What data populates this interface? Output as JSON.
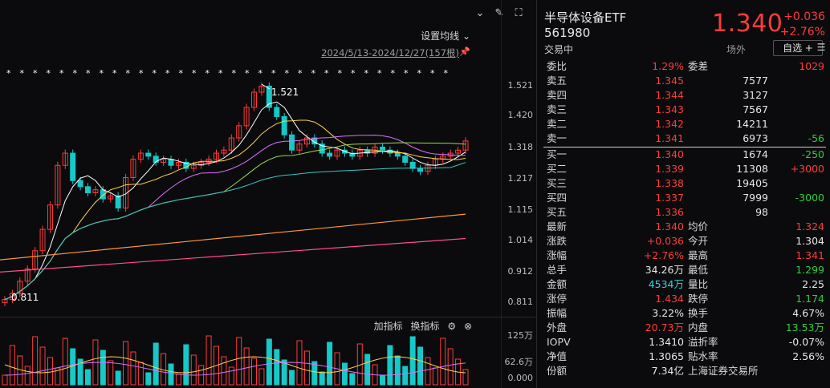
{
  "chart": {
    "ma_settings": "设置均线",
    "range": "2024/5/13-2024/12/27(157根)",
    "price_ticks": [
      "1.521",
      "1.420",
      "1.318",
      "1.217",
      "1.115",
      "1.014",
      "0.912",
      "0.811"
    ],
    "max_label": "1.521",
    "min_label": "0.811",
    "volume_tools": {
      "add": "加指标",
      "swap": "换指标"
    },
    "volume_ticks": [
      "125万",
      "62.6万",
      "0.000"
    ],
    "colors": {
      "up": "#ff3b3b",
      "down": "#16c8c8",
      "ma5": "#ffffff",
      "ma10": "#ffd24a",
      "ma20": "#e070ff",
      "ma30": "#9bd94a",
      "ma60": "#38c6c0",
      "ma120": "#ff9a30",
      "ma250": "#ff4d88"
    }
  },
  "chart_data": {
    "type": "candlestick",
    "ylim": [
      0.811,
      1.521
    ],
    "ohlc_close_approx": [
      0.82,
      0.84,
      0.88,
      0.92,
      0.98,
      1.05,
      1.13,
      1.26,
      1.3,
      1.21,
      1.19,
      1.17,
      1.18,
      1.15,
      1.16,
      1.12,
      1.22,
      1.28,
      1.3,
      1.29,
      1.27,
      1.28,
      1.26,
      1.27,
      1.25,
      1.26,
      1.27,
      1.28,
      1.3,
      1.31,
      1.35,
      1.39,
      1.45,
      1.5,
      1.52,
      1.45,
      1.42,
      1.36,
      1.31,
      1.33,
      1.35,
      1.33,
      1.3,
      1.29,
      1.31,
      1.3,
      1.29,
      1.31,
      1.3,
      1.32,
      1.31,
      1.3,
      1.29,
      1.27,
      1.25,
      1.24,
      1.26,
      1.28,
      1.29,
      1.3,
      1.31,
      1.34
    ]
  },
  "quote": {
    "name": "半导体设备ETF",
    "code": "561980",
    "status": "交易中",
    "last": "1.340",
    "change": "+0.036",
    "change_pct": "+2.76%",
    "outer_label": "场外",
    "add_button": "自选 +",
    "committee": {
      "ratio_label": "委比",
      "ratio": "1.29%",
      "diff_label": "委差",
      "diff": "1029"
    },
    "asks": [
      {
        "label": "卖五",
        "price": "1.345",
        "vol": "7577",
        "chg": ""
      },
      {
        "label": "卖四",
        "price": "1.344",
        "vol": "3127",
        "chg": ""
      },
      {
        "label": "卖三",
        "price": "1.343",
        "vol": "7567",
        "chg": ""
      },
      {
        "label": "卖二",
        "price": "1.342",
        "vol": "14211",
        "chg": ""
      },
      {
        "label": "卖一",
        "price": "1.341",
        "vol": "6973",
        "chg": "-56"
      }
    ],
    "bids": [
      {
        "label": "买一",
        "price": "1.340",
        "vol": "1674",
        "chg": "-250"
      },
      {
        "label": "买二",
        "price": "1.339",
        "vol": "11308",
        "chg": "+3000"
      },
      {
        "label": "买三",
        "price": "1.338",
        "vol": "19405",
        "chg": ""
      },
      {
        "label": "买四",
        "price": "1.337",
        "vol": "7999",
        "chg": "-3000"
      },
      {
        "label": "买五",
        "price": "1.336",
        "vol": "98",
        "chg": ""
      }
    ],
    "stats": [
      {
        "l1": "最新",
        "v1": "1.340",
        "c1": "red",
        "l2": "均价",
        "v2": "1.324",
        "c2": "red"
      },
      {
        "l1": "涨跌",
        "v1": "+0.036",
        "c1": "red",
        "l2": "今开",
        "v2": "1.304",
        "c2": "white"
      },
      {
        "l1": "涨幅",
        "v1": "+2.76%",
        "c1": "red",
        "l2": "最高",
        "v2": "1.341",
        "c2": "red"
      },
      {
        "l1": "总手",
        "v1": "34.26万",
        "c1": "white",
        "l2": "最低",
        "v2": "1.299",
        "c2": "green"
      },
      {
        "l1": "金额",
        "v1": "4534万",
        "c1": "cyan",
        "l2": "量比",
        "v2": "2.25",
        "c2": "white"
      },
      {
        "l1": "涨停",
        "v1": "1.434",
        "c1": "red",
        "l2": "跌停",
        "v2": "1.174",
        "c2": "green"
      },
      {
        "l1": "振幅",
        "v1": "3.22%",
        "c1": "white",
        "l2": "换手",
        "v2": "4.67%",
        "c2": "white"
      },
      {
        "l1": "外盘",
        "v1": "20.73万",
        "c1": "red",
        "l2": "内盘",
        "v2": "13.53万",
        "c2": "green"
      },
      {
        "l1": "IOPV",
        "v1": "1.3410",
        "c1": "white",
        "l2": "溢折率",
        "v2": "-0.07%",
        "c2": "white"
      },
      {
        "l1": "净值",
        "v1": "1.3065",
        "c1": "white",
        "l2": "贴水率",
        "v2": "2.56%",
        "c2": "white"
      },
      {
        "l1": "份额",
        "v1": "7.34亿",
        "c1": "white",
        "l2": "上海证券交易所",
        "v2": "",
        "c2": "white"
      }
    ]
  }
}
